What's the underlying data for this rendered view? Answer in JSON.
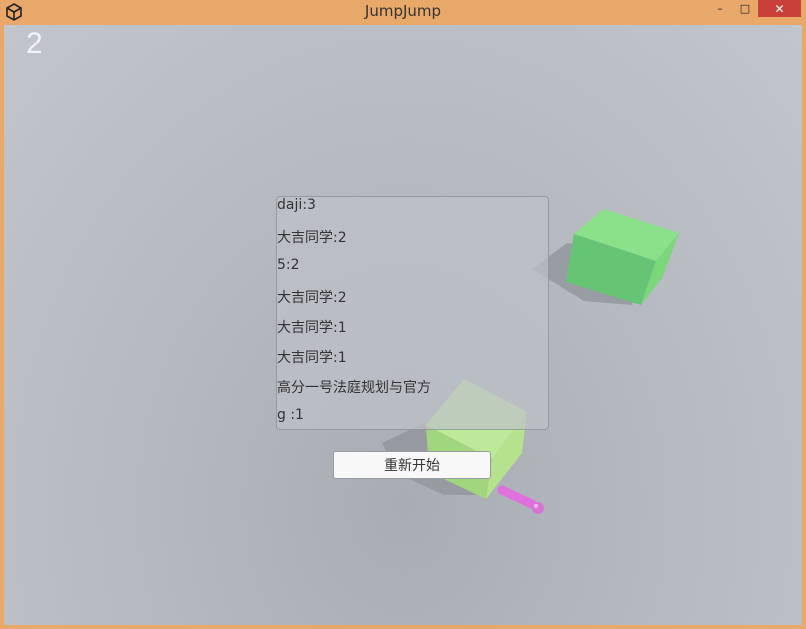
{
  "window": {
    "title": "JumpJump",
    "minimize_label": "–",
    "maximize_label": "□",
    "close_label": "✕"
  },
  "game": {
    "score": "2"
  },
  "ranking": {
    "rows": [
      "daji:3",
      "大吉同学:2",
      "5:2",
      "大吉同学:2",
      "大吉同学:1",
      "大吉同学:1",
      "高分一号法庭规划与官方",
      "g :1"
    ]
  },
  "restart_button": {
    "label": "重新开始"
  },
  "colors": {
    "titlebar": "#e8a86a",
    "close_button": "#c9403a",
    "cube_far": "#6ed27a",
    "cube_near": "#a8e07f",
    "player": "#e07ad8"
  }
}
